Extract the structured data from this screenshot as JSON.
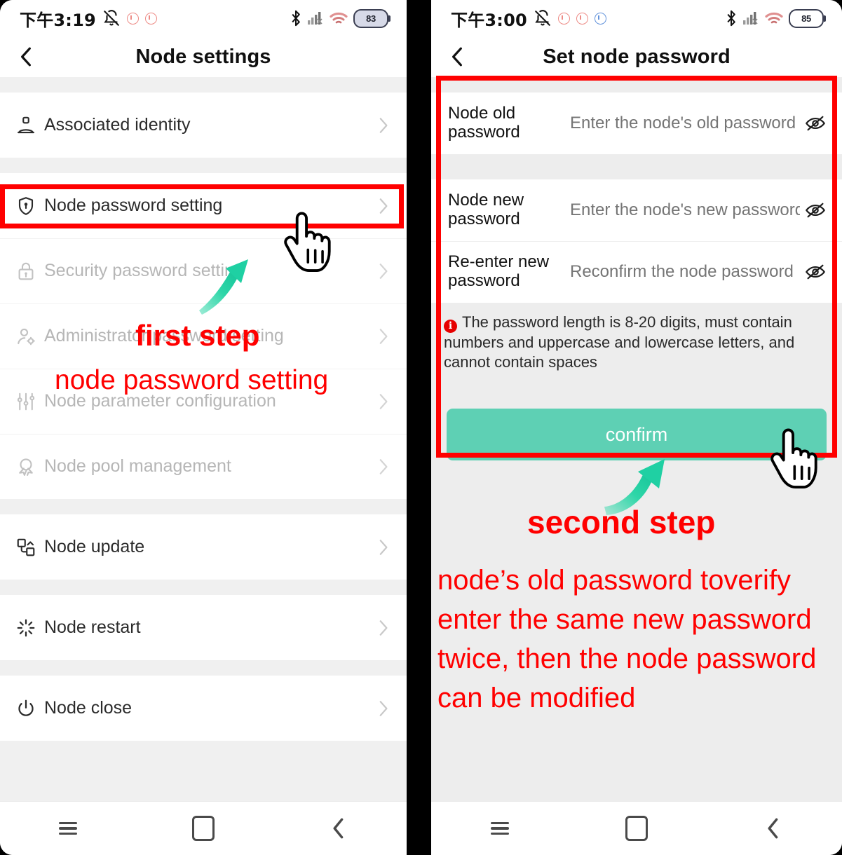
{
  "left_phone": {
    "status_bar": {
      "time": "下午3:19",
      "battery_level": "83",
      "icons": [
        "bell-off-icon",
        "notification-dot-icon",
        "notification-dot-icon",
        "bluetooth-icon",
        "signal-icon",
        "wifi-icon",
        "battery-icon"
      ]
    },
    "title": "Node settings",
    "back_icon": "chevron-left-icon",
    "items": [
      {
        "label": "Associated identity",
        "icon": "person-badge-icon",
        "disabled": false
      },
      {
        "label": "Node password setting",
        "icon": "shield-key-icon",
        "disabled": false
      },
      {
        "label": "Security password setting",
        "icon": "padlock-icon",
        "disabled": true
      },
      {
        "label": "Administrator password setting",
        "icon": "person-gear-icon",
        "disabled": true
      },
      {
        "label": "Node parameter configuration",
        "icon": "sliders-icon",
        "disabled": true
      },
      {
        "label": "Node pool management",
        "icon": "node-pool-icon",
        "disabled": true
      },
      {
        "label": "Node update",
        "icon": "node-update-icon",
        "disabled": false
      },
      {
        "label": "Node restart",
        "icon": "restart-icon",
        "disabled": false
      },
      {
        "label": "Node close",
        "icon": "power-icon",
        "disabled": false
      }
    ],
    "annotations": {
      "step_title": "first step",
      "step_detail": "node password setting"
    },
    "nav_bar": [
      "recents-icon",
      "home-icon",
      "back-icon"
    ]
  },
  "right_phone": {
    "status_bar": {
      "time": "下午3:00",
      "battery_level": "85",
      "icons": [
        "bell-off-icon",
        "notification-dot-icon",
        "notification-dot-icon",
        "notification-dot-blue-icon",
        "bluetooth-icon",
        "signal-icon",
        "wifi-icon",
        "battery-icon"
      ]
    },
    "title": "Set node password",
    "back_icon": "chevron-left-icon",
    "fields": [
      {
        "label": "Node old password",
        "placeholder": "Enter the node's old password",
        "value": "",
        "eye_icon": "eye-slash-icon"
      },
      {
        "label": "Node new password",
        "placeholder": "Enter the node's new password",
        "value": "",
        "eye_icon": "eye-slash-icon"
      },
      {
        "label": "Re-enter new password",
        "placeholder": "Reconfirm the node password",
        "value": "",
        "eye_icon": "eye-slash-icon"
      }
    ],
    "hint": "The password length is 8-20 digits, must contain numbers and uppercase and lowercase letters, and cannot contain spaces",
    "hint_icon": "error-info-icon",
    "confirm_label": "confirm",
    "annotations": {
      "step_title": "second step",
      "lines": [
        "node’s old password toverify",
        "enter the same new password",
        "twice, then the node password",
        "can be modified"
      ]
    },
    "nav_bar": [
      "recents-icon",
      "home-icon",
      "back-icon"
    ]
  },
  "colors": {
    "accent_green": "#5ed0b4",
    "annotation_red": "#ff0000",
    "arrow_green": "#2ed6a8",
    "error_red": "#e60000",
    "panel_bg": "#ededed",
    "list_bg": "#f0f0f0"
  }
}
